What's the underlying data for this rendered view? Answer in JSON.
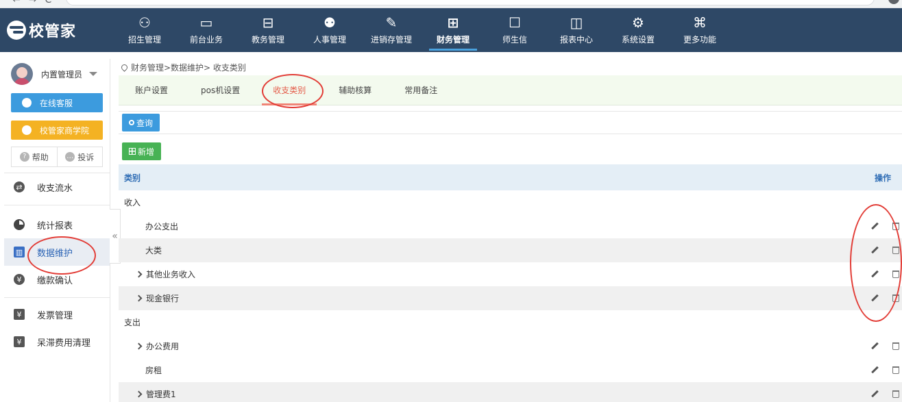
{
  "app": {
    "logo_text": "校管家"
  },
  "nav": [
    {
      "label": "招生管理",
      "icon": "person-badge-icon"
    },
    {
      "label": "前台业务",
      "icon": "monitor-icon"
    },
    {
      "label": "教务管理",
      "icon": "box-icon"
    },
    {
      "label": "人事管理",
      "icon": "people-icon"
    },
    {
      "label": "进销存管理",
      "icon": "edit-box-icon"
    },
    {
      "label": "财务管理",
      "icon": "finance-screen-icon",
      "active": true
    },
    {
      "label": "师生信",
      "icon": "chat-icon"
    },
    {
      "label": "报表中心",
      "icon": "chart-screen-icon"
    },
    {
      "label": "系统设置",
      "icon": "gear-icon"
    },
    {
      "label": "更多功能",
      "icon": "command-icon"
    }
  ],
  "sidebar": {
    "user_name": "内置管理员",
    "online_service": "在线客服",
    "academy": "校管家商学院",
    "help": "帮助",
    "complaint": "投诉",
    "items": [
      {
        "label": "收支流水"
      },
      {
        "label": "统计报表"
      },
      {
        "label": "数据维护",
        "active": true
      },
      {
        "label": "缴款确认"
      },
      {
        "label": "发票管理"
      },
      {
        "label": "呆滞费用清理"
      }
    ]
  },
  "breadcrumb": "财务管理>数据维护> 收支类别",
  "tabs": [
    {
      "label": "账户设置"
    },
    {
      "label": "pos机设置"
    },
    {
      "label": "收支类别",
      "active": true
    },
    {
      "label": "辅助核算"
    },
    {
      "label": "常用备注"
    }
  ],
  "buttons": {
    "query": "查询",
    "add": "新增"
  },
  "table": {
    "col_category": "类别",
    "col_ops": "操作",
    "rows": [
      {
        "name": "收入",
        "level": "group"
      },
      {
        "name": "办公支出",
        "level": "child",
        "expandable": false
      },
      {
        "name": "大类",
        "level": "child",
        "expandable": false
      },
      {
        "name": "其他业务收入",
        "level": "child",
        "expandable": true
      },
      {
        "name": "现金银行",
        "level": "child",
        "expandable": true
      },
      {
        "name": "支出",
        "level": "group"
      },
      {
        "name": "办公费用",
        "level": "child",
        "expandable": true
      },
      {
        "name": "房租",
        "level": "child",
        "expandable": false
      },
      {
        "name": "管理费1",
        "level": "child",
        "expandable": true
      }
    ]
  },
  "colors": {
    "topbar": "#2e4866",
    "accent_blue": "#3c9bde",
    "accent_orange": "#f4b223",
    "accent_green": "#47b254",
    "active_tab": "#e45c4a",
    "annotation": "#e23c36"
  }
}
